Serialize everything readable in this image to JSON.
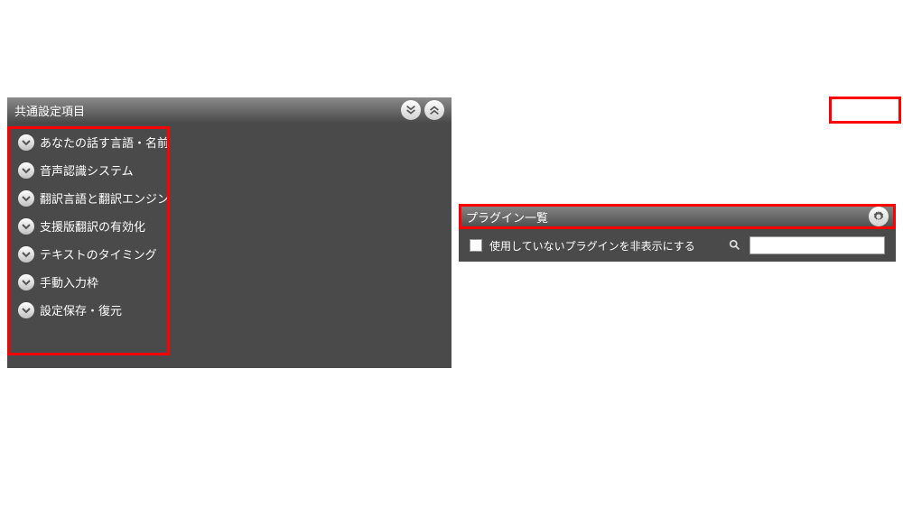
{
  "leftPanel": {
    "title": "共通設定項目",
    "items": [
      {
        "label": "あなたの話す言語・名前"
      },
      {
        "label": "音声認識システム"
      },
      {
        "label": "翻訳言語と翻訳エンジン"
      },
      {
        "label": "支援版翻訳の有効化"
      },
      {
        "label": "テキストのタイミング"
      },
      {
        "label": "手動入力枠"
      },
      {
        "label": "設定保存・復元"
      }
    ]
  },
  "rightPanel": {
    "title": "プラグイン一覧",
    "filterLabel": "使用していないプラグインを非表示にする",
    "searchValue": ""
  }
}
